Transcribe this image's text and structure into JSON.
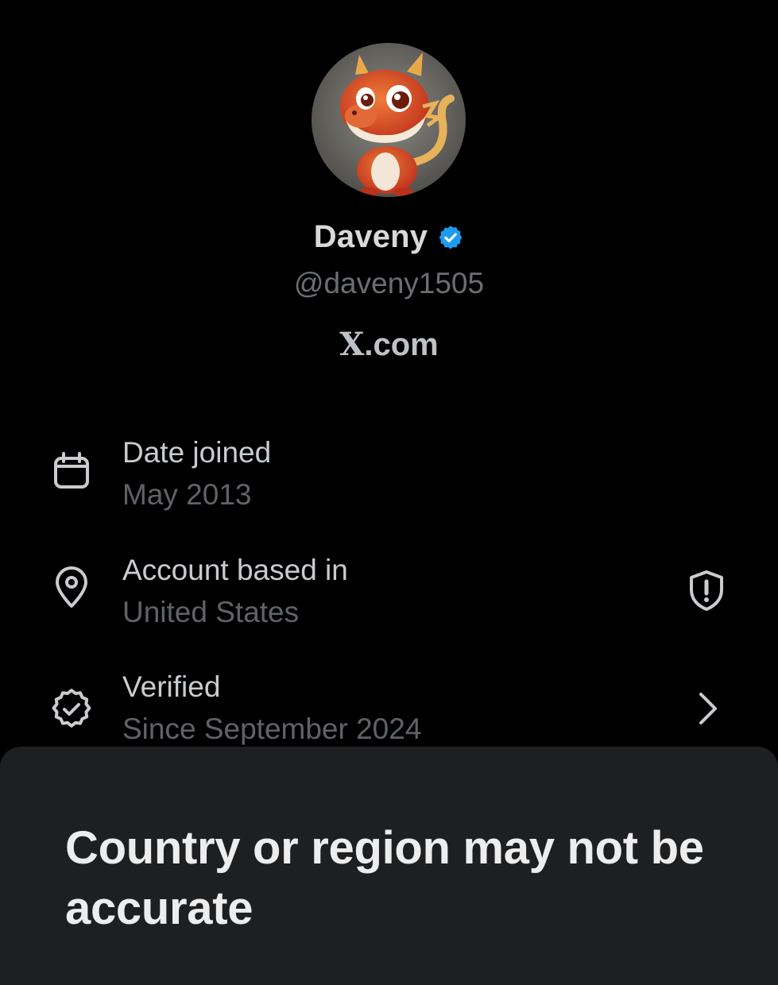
{
  "profile": {
    "display_name": "Daveny",
    "handle": "@daveny1505",
    "site": "X.com",
    "site_prefix": "X",
    "site_suffix": ".com",
    "avatar_icon": "dragon-avatar-icon",
    "badge_icon": "verified-badge-icon",
    "badge_color": "#1d9bf0"
  },
  "about": {
    "items": [
      {
        "icon": "calendar-icon",
        "title": "Date joined",
        "value": "May 2013"
      },
      {
        "icon": "location-pin-icon",
        "title": "Account based in",
        "value": "United States",
        "trailing_icon": "shield-alert-icon"
      },
      {
        "icon": "verified-check-icon",
        "title": "Verified",
        "value": "Since September 2024",
        "trailing_icon": "chevron-right-icon"
      }
    ]
  },
  "sheet": {
    "title": "Country or region may not be accurate"
  },
  "colors": {
    "background": "#000000",
    "sheet_background": "#1e1f21",
    "muted_text": "#5f6367"
  }
}
